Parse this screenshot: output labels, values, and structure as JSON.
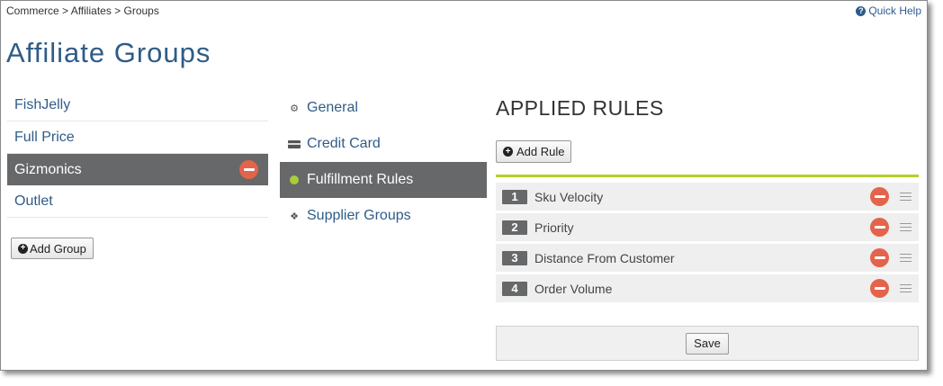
{
  "breadcrumb": "Commerce > Affiliates > Groups",
  "quick_help": "Quick Help",
  "page_title": "Affiliate Groups",
  "groups": {
    "items": [
      {
        "label": "FishJelly"
      },
      {
        "label": "Full Price"
      },
      {
        "label": "Gizmonics",
        "selected": true
      },
      {
        "label": "Outlet"
      }
    ],
    "add_label": "Add Group"
  },
  "nav": {
    "items": [
      {
        "label": "General",
        "icon": "gear-icon"
      },
      {
        "label": "Credit Card",
        "icon": "credit-card-icon"
      },
      {
        "label": "Fulfillment Rules",
        "icon": "globe-icon",
        "selected": true
      },
      {
        "label": "Supplier Groups",
        "icon": "boxes-icon"
      }
    ]
  },
  "rules": {
    "title": "APPLIED RULES",
    "add_label": "Add Rule",
    "items": [
      {
        "num": "1",
        "name": "Sku Velocity"
      },
      {
        "num": "2",
        "name": "Priority"
      },
      {
        "num": "3",
        "name": "Distance From Customer"
      },
      {
        "num": "4",
        "name": "Order Volume"
      }
    ],
    "save_label": "Save"
  },
  "colors": {
    "accent_blue": "#2f5c88",
    "active_gray": "#666869",
    "remove_red": "#e3644b",
    "rule_line_green": "#b5cf2a"
  }
}
